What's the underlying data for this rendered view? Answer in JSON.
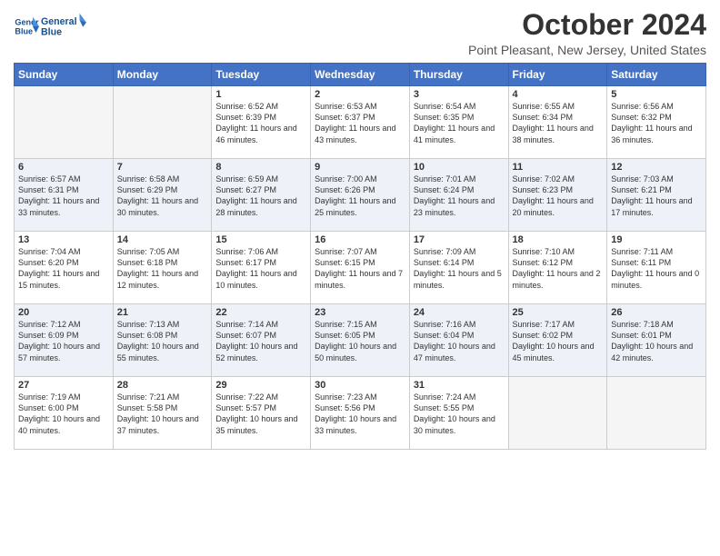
{
  "logo": {
    "line1": "General",
    "line2": "Blue"
  },
  "header": {
    "month": "October 2024",
    "location": "Point Pleasant, New Jersey, United States"
  },
  "days_of_week": [
    "Sunday",
    "Monday",
    "Tuesday",
    "Wednesday",
    "Thursday",
    "Friday",
    "Saturday"
  ],
  "weeks": [
    [
      {
        "day": "",
        "empty": true
      },
      {
        "day": "",
        "empty": true
      },
      {
        "day": "1",
        "sunrise": "6:52 AM",
        "sunset": "6:39 PM",
        "daylight": "11 hours and 46 minutes."
      },
      {
        "day": "2",
        "sunrise": "6:53 AM",
        "sunset": "6:37 PM",
        "daylight": "11 hours and 43 minutes."
      },
      {
        "day": "3",
        "sunrise": "6:54 AM",
        "sunset": "6:35 PM",
        "daylight": "11 hours and 41 minutes."
      },
      {
        "day": "4",
        "sunrise": "6:55 AM",
        "sunset": "6:34 PM",
        "daylight": "11 hours and 38 minutes."
      },
      {
        "day": "5",
        "sunrise": "6:56 AM",
        "sunset": "6:32 PM",
        "daylight": "11 hours and 36 minutes."
      }
    ],
    [
      {
        "day": "6",
        "sunrise": "6:57 AM",
        "sunset": "6:31 PM",
        "daylight": "11 hours and 33 minutes."
      },
      {
        "day": "7",
        "sunrise": "6:58 AM",
        "sunset": "6:29 PM",
        "daylight": "11 hours and 30 minutes."
      },
      {
        "day": "8",
        "sunrise": "6:59 AM",
        "sunset": "6:27 PM",
        "daylight": "11 hours and 28 minutes."
      },
      {
        "day": "9",
        "sunrise": "7:00 AM",
        "sunset": "6:26 PM",
        "daylight": "11 hours and 25 minutes."
      },
      {
        "day": "10",
        "sunrise": "7:01 AM",
        "sunset": "6:24 PM",
        "daylight": "11 hours and 23 minutes."
      },
      {
        "day": "11",
        "sunrise": "7:02 AM",
        "sunset": "6:23 PM",
        "daylight": "11 hours and 20 minutes."
      },
      {
        "day": "12",
        "sunrise": "7:03 AM",
        "sunset": "6:21 PM",
        "daylight": "11 hours and 17 minutes."
      }
    ],
    [
      {
        "day": "13",
        "sunrise": "7:04 AM",
        "sunset": "6:20 PM",
        "daylight": "11 hours and 15 minutes."
      },
      {
        "day": "14",
        "sunrise": "7:05 AM",
        "sunset": "6:18 PM",
        "daylight": "11 hours and 12 minutes."
      },
      {
        "day": "15",
        "sunrise": "7:06 AM",
        "sunset": "6:17 PM",
        "daylight": "11 hours and 10 minutes."
      },
      {
        "day": "16",
        "sunrise": "7:07 AM",
        "sunset": "6:15 PM",
        "daylight": "11 hours and 7 minutes."
      },
      {
        "day": "17",
        "sunrise": "7:09 AM",
        "sunset": "6:14 PM",
        "daylight": "11 hours and 5 minutes."
      },
      {
        "day": "18",
        "sunrise": "7:10 AM",
        "sunset": "6:12 PM",
        "daylight": "11 hours and 2 minutes."
      },
      {
        "day": "19",
        "sunrise": "7:11 AM",
        "sunset": "6:11 PM",
        "daylight": "11 hours and 0 minutes."
      }
    ],
    [
      {
        "day": "20",
        "sunrise": "7:12 AM",
        "sunset": "6:09 PM",
        "daylight": "10 hours and 57 minutes."
      },
      {
        "day": "21",
        "sunrise": "7:13 AM",
        "sunset": "6:08 PM",
        "daylight": "10 hours and 55 minutes."
      },
      {
        "day": "22",
        "sunrise": "7:14 AM",
        "sunset": "6:07 PM",
        "daylight": "10 hours and 52 minutes."
      },
      {
        "day": "23",
        "sunrise": "7:15 AM",
        "sunset": "6:05 PM",
        "daylight": "10 hours and 50 minutes."
      },
      {
        "day": "24",
        "sunrise": "7:16 AM",
        "sunset": "6:04 PM",
        "daylight": "10 hours and 47 minutes."
      },
      {
        "day": "25",
        "sunrise": "7:17 AM",
        "sunset": "6:02 PM",
        "daylight": "10 hours and 45 minutes."
      },
      {
        "day": "26",
        "sunrise": "7:18 AM",
        "sunset": "6:01 PM",
        "daylight": "10 hours and 42 minutes."
      }
    ],
    [
      {
        "day": "27",
        "sunrise": "7:19 AM",
        "sunset": "6:00 PM",
        "daylight": "10 hours and 40 minutes."
      },
      {
        "day": "28",
        "sunrise": "7:21 AM",
        "sunset": "5:58 PM",
        "daylight": "10 hours and 37 minutes."
      },
      {
        "day": "29",
        "sunrise": "7:22 AM",
        "sunset": "5:57 PM",
        "daylight": "10 hours and 35 minutes."
      },
      {
        "day": "30",
        "sunrise": "7:23 AM",
        "sunset": "5:56 PM",
        "daylight": "10 hours and 33 minutes."
      },
      {
        "day": "31",
        "sunrise": "7:24 AM",
        "sunset": "5:55 PM",
        "daylight": "10 hours and 30 minutes."
      },
      {
        "day": "",
        "empty": true
      },
      {
        "day": "",
        "empty": true
      }
    ]
  ],
  "labels": {
    "sunrise_prefix": "Sunrise: ",
    "sunset_prefix": "Sunset: ",
    "daylight_prefix": "Daylight: "
  }
}
